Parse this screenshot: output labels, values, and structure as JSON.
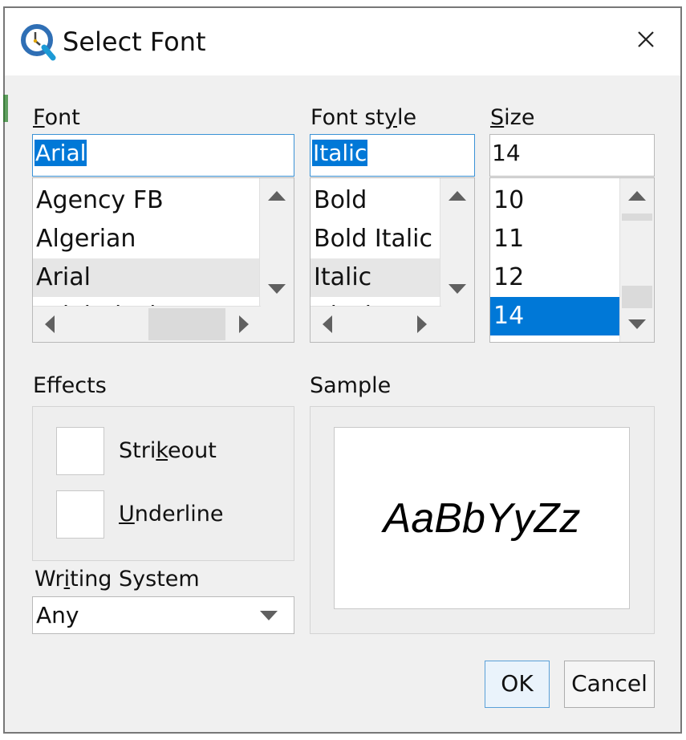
{
  "window": {
    "title": "Select Font",
    "icon": "app-logo-icon",
    "close_icon": "close-icon"
  },
  "font": {
    "label_mnemonic": "F",
    "label_rest": "ont",
    "value": "Arial",
    "items": [
      "Agency FB",
      "Algerian",
      "Arial",
      "Arial Black"
    ],
    "current_index": 2
  },
  "font_style": {
    "label_pre": "Font st",
    "label_mnemonic": "y",
    "label_rest": "le",
    "value": "Italic",
    "items": [
      "Bold",
      "Bold Italic",
      "Italic",
      "Black"
    ],
    "current_index": 2
  },
  "size": {
    "label_mnemonic": "S",
    "label_rest": "ize",
    "value": "14",
    "items": [
      "10",
      "11",
      "12",
      "14"
    ],
    "selected_index": 3
  },
  "effects": {
    "label": "Effects",
    "strikeout": {
      "pre": "Stri",
      "mnemonic": "k",
      "rest": "eout",
      "checked": false
    },
    "underline": {
      "pre": "",
      "mnemonic": "U",
      "rest": "nderline",
      "checked": false
    }
  },
  "writing_system": {
    "label_pre": "Wr",
    "label_mnemonic": "i",
    "label_rest": "ting System",
    "value": "Any"
  },
  "sample": {
    "label": "Sample",
    "text": "AaBbYyZz"
  },
  "buttons": {
    "ok": "OK",
    "cancel": "Cancel"
  },
  "colors": {
    "selection": "#0078d7",
    "dialog_bg": "#f0f0f0",
    "focus_border": "#3a92d6"
  }
}
